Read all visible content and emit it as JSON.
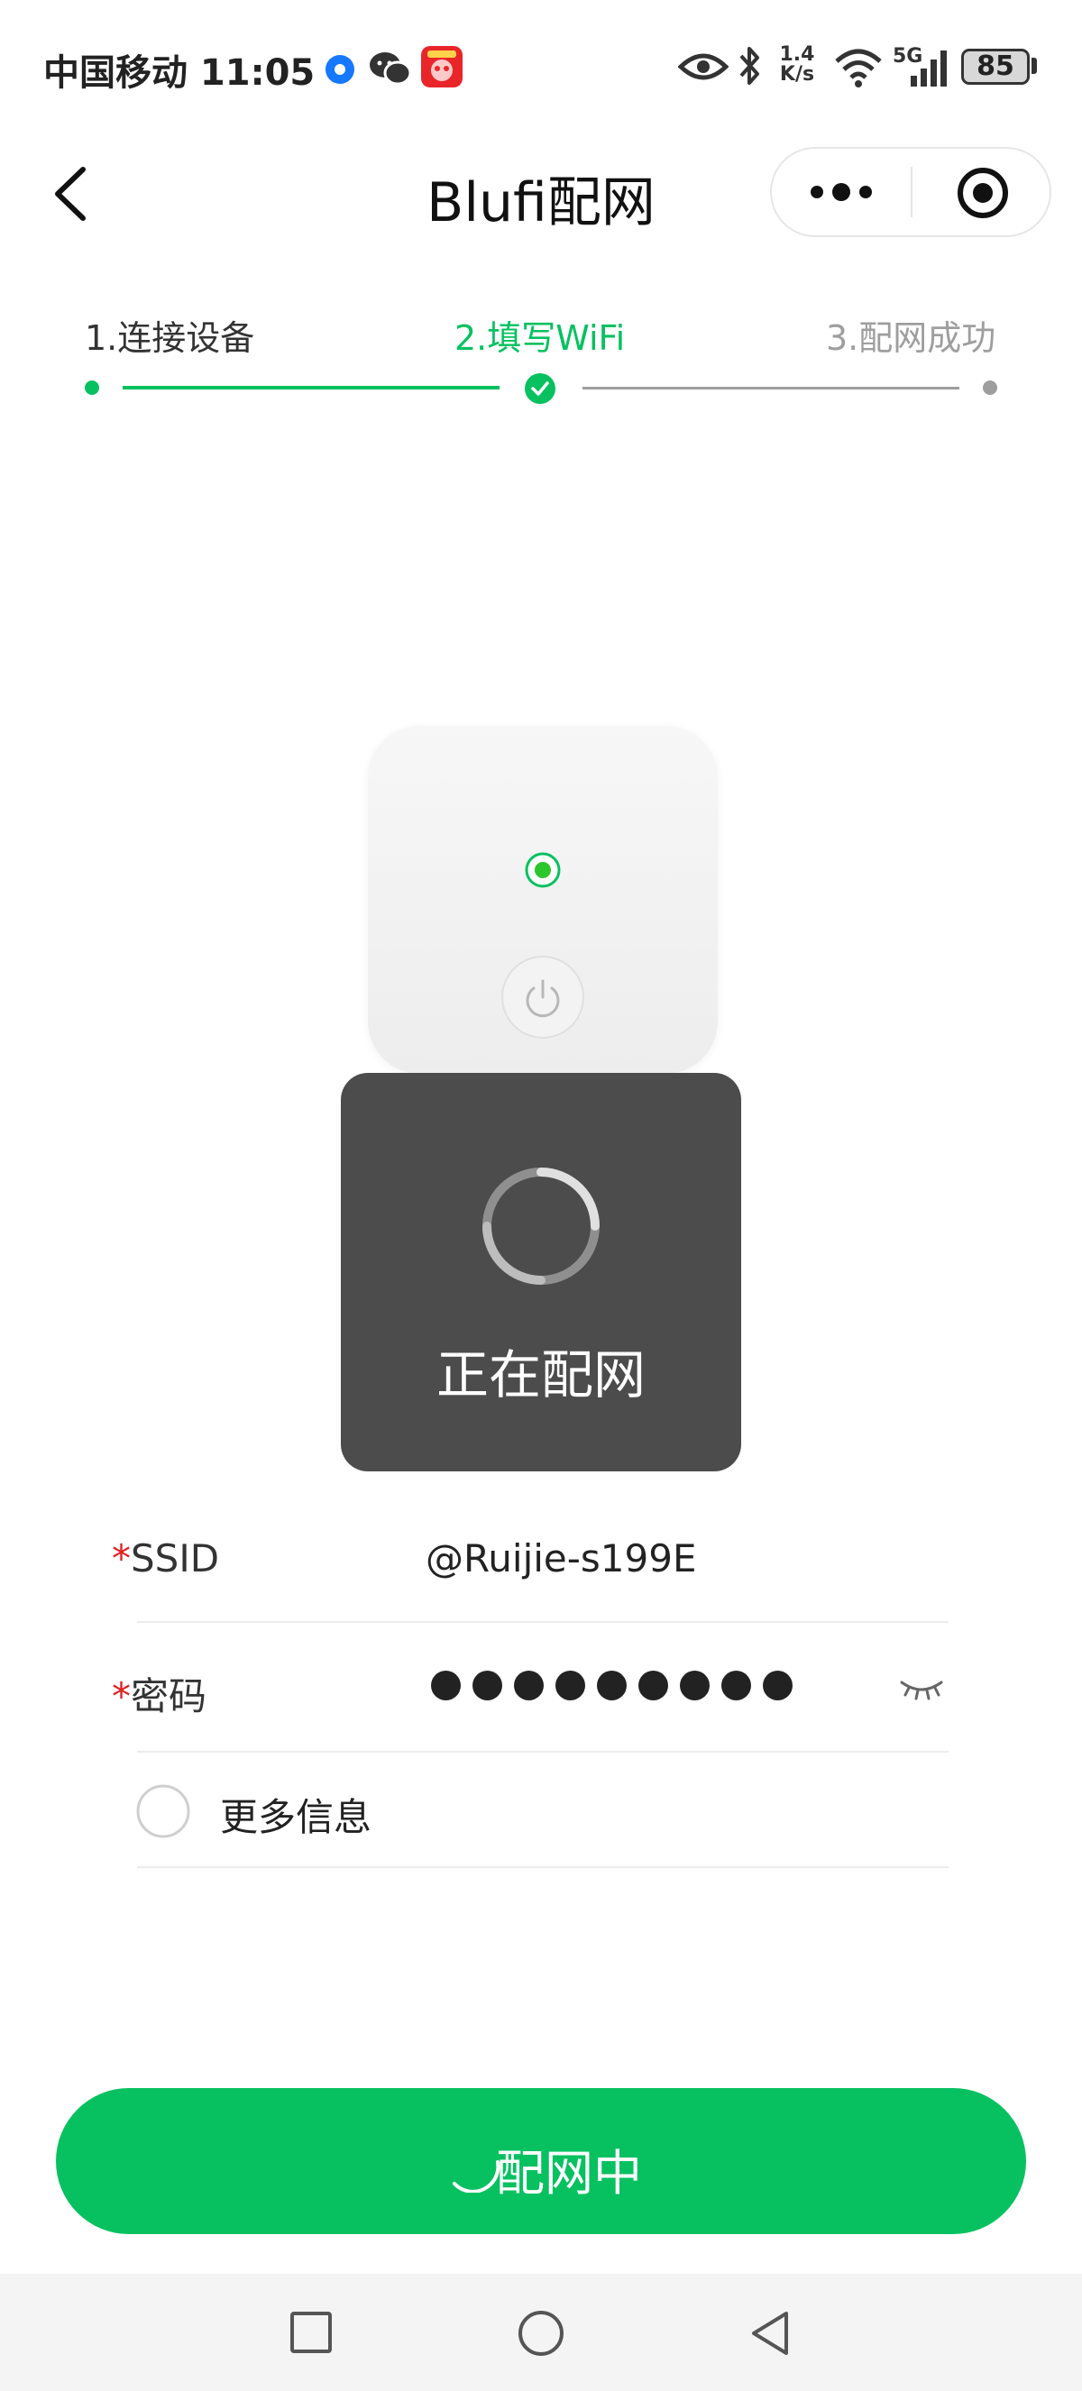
{
  "status_bar": {
    "carrier_time": "中国移动 11:05",
    "net_speed_top": "1.4",
    "net_speed_bottom": "K/s",
    "signal_label": "5G",
    "battery": "85",
    "icons": [
      "location-icon",
      "wechat-icon",
      "app-badge-icon",
      "eye-icon",
      "bluetooth-icon",
      "wifi-icon",
      "signal-icon",
      "battery-icon"
    ]
  },
  "nav": {
    "title": "Blufi配网",
    "icons": [
      "back-arrow-icon",
      "more-dots-icon",
      "close-circle-icon"
    ]
  },
  "steps": {
    "items": [
      {
        "label": "1.连接设备",
        "state": "done"
      },
      {
        "label": "2.填写WiFi",
        "state": "active"
      },
      {
        "label": "3.配网成功",
        "state": "pending"
      }
    ],
    "colors": {
      "active": "#07c160",
      "pending": "#9e9e9e",
      "done_text": "#333333"
    }
  },
  "device": {
    "icons": [
      "indicator-led-icon",
      "power-button-icon"
    ]
  },
  "toast": {
    "text": "正在配网",
    "icon": "spinner-icon"
  },
  "form": {
    "required_mark": "*",
    "ssid_label": "SSID",
    "ssid_value": "@Ruijie-s199E",
    "password_label": "密码",
    "password_length": 9,
    "password_toggle_icon": "eye-closed-icon",
    "more_info_label": "更多信息"
  },
  "submit": {
    "label": "配网中",
    "icon": "button-spinner-icon",
    "color": "#07c160"
  },
  "system_nav": {
    "icons": [
      "recent-apps-icon",
      "home-icon",
      "back-icon"
    ]
  }
}
